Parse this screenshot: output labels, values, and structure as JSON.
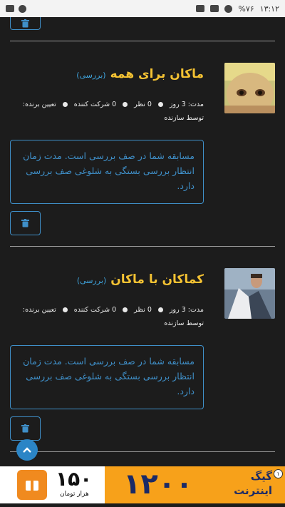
{
  "status_bar": {
    "time": "۱۳:۱۲",
    "battery": "%۷۶"
  },
  "entries": [
    {
      "title": "ماکان برای همه",
      "status": "(بررسی)",
      "duration": "مدت: 3 روز",
      "comments": "0 نظر",
      "participants": "0 شرکت کننده",
      "winner": "تعیین برنده:",
      "creator": "توسط سازنده",
      "notice": "مسابقه شما در صف بررسی است. مدت زمان انتظار بررسی بستگی به شلوغی صف بررسی دارد."
    },
    {
      "title": "کماکان با ماکان",
      "status": "(بررسی)",
      "duration": "مدت: 3 روز",
      "comments": "0 نظر",
      "participants": "0 شرکت کننده",
      "winner": "تعیین برنده:",
      "creator": "توسط سازنده",
      "notice": "مسابقه شما در صف بررسی است. مدت زمان انتظار بررسی بستگی به شلوغی صف بررسی دارد."
    }
  ],
  "ad": {
    "price": "۱۵۰",
    "unit": "هزار تومان",
    "big_number": "۱۲۰۰",
    "line1": "گیگ",
    "line2": "اینترنت",
    "badge": "۱"
  },
  "icons": {
    "trash": "trash-icon",
    "scroll_top": "chevron-up-icon"
  },
  "colors": {
    "background": "#1c1c1c",
    "title": "#f4c233",
    "accent": "#3f8fc8",
    "status_tag": "#3fa4dd"
  }
}
